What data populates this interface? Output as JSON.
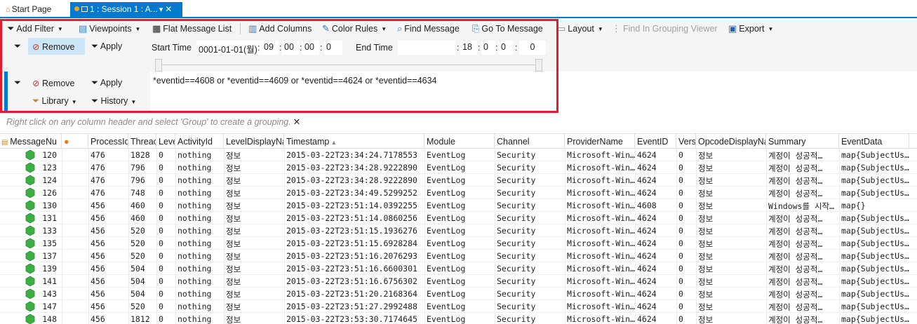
{
  "tabs": {
    "start": "Start Page",
    "session": "1 : Session 1 : A..."
  },
  "toolbar": {
    "add_filter": "Add Filter",
    "viewpoints": "Viewpoints",
    "flat_message_list": "Flat Message List",
    "add_columns": "Add Columns",
    "color_rules": "Color Rules",
    "find_message": "Find Message",
    "go_to_message": "Go To Message",
    "layout": "Layout",
    "find_in_grouping": "Find In Grouping Viewer",
    "export": "Export"
  },
  "time_filter": {
    "remove": "Remove",
    "apply": "Apply",
    "start_label": "Start Time",
    "start_date": "0001-01-01(월)",
    "start_h": "09",
    "start_m": "00",
    "start_s": "00",
    "start_f": "0",
    "end_label": "End Time",
    "end_date": "",
    "end_h": "18",
    "end_m": "0",
    "end_s": "0",
    "end_f": "0"
  },
  "filter": {
    "remove": "Remove",
    "apply": "Apply",
    "library": "Library",
    "history": "History",
    "expression": "*eventid==4608 or *eventid==4609 or *eventid==4624 or *eventid==4634"
  },
  "grouping_hint": "Right click on any column header and select 'Group' to create a grouping.",
  "grid": {
    "columns": [
      "MessageNu",
      "",
      "ProcessId",
      "Threac",
      "Leve",
      "ActivityId",
      "LevelDisplayNa",
      "Timestamp",
      "Module",
      "Channel",
      "ProviderName",
      "EventID",
      "Vers",
      "OpcodeDisplayNa",
      "Summary",
      "EventData"
    ],
    "rows": [
      [
        "120",
        "476",
        "1828",
        "0",
        "nothing",
        "정보",
        "2015-03-22T23:34:24.7178553",
        "EventLog",
        "Security",
        "Microsoft-Win…",
        "4624",
        "0",
        "정보",
        "계정이 성공적…",
        "map{SubjectUs…"
      ],
      [
        "123",
        "476",
        "796",
        "0",
        "nothing",
        "정보",
        "2015-03-22T23:34:28.9222890",
        "EventLog",
        "Security",
        "Microsoft-Win…",
        "4624",
        "0",
        "정보",
        "계정이 성공적…",
        "map{SubjectUs…"
      ],
      [
        "124",
        "476",
        "796",
        "0",
        "nothing",
        "정보",
        "2015-03-22T23:34:28.9222890",
        "EventLog",
        "Security",
        "Microsoft-Win…",
        "4624",
        "0",
        "정보",
        "계정이 성공적…",
        "map{SubjectUs…"
      ],
      [
        "126",
        "476",
        "748",
        "0",
        "nothing",
        "정보",
        "2015-03-22T23:34:49.5299252",
        "EventLog",
        "Security",
        "Microsoft-Win…",
        "4624",
        "0",
        "정보",
        "계정이 성공적…",
        "map{SubjectUs…"
      ],
      [
        "130",
        "456",
        "460",
        "0",
        "nothing",
        "정보",
        "2015-03-22T23:51:14.0392255",
        "EventLog",
        "Security",
        "Microsoft-Win…",
        "4608",
        "0",
        "정보",
        "Windows를 시작…",
        "map{}"
      ],
      [
        "131",
        "456",
        "460",
        "0",
        "nothing",
        "정보",
        "2015-03-22T23:51:14.0860256",
        "EventLog",
        "Security",
        "Microsoft-Win…",
        "4624",
        "0",
        "정보",
        "계정이 성공적…",
        "map{SubjectUs…"
      ],
      [
        "133",
        "456",
        "520",
        "0",
        "nothing",
        "정보",
        "2015-03-22T23:51:15.1936276",
        "EventLog",
        "Security",
        "Microsoft-Win…",
        "4624",
        "0",
        "정보",
        "계정이 성공적…",
        "map{SubjectUs…"
      ],
      [
        "135",
        "456",
        "520",
        "0",
        "nothing",
        "정보",
        "2015-03-22T23:51:15.6928284",
        "EventLog",
        "Security",
        "Microsoft-Win…",
        "4624",
        "0",
        "정보",
        "계정이 성공적…",
        "map{SubjectUs…"
      ],
      [
        "137",
        "456",
        "520",
        "0",
        "nothing",
        "정보",
        "2015-03-22T23:51:16.2076293",
        "EventLog",
        "Security",
        "Microsoft-Win…",
        "4624",
        "0",
        "정보",
        "계정이 성공적…",
        "map{SubjectUs…"
      ],
      [
        "139",
        "456",
        "504",
        "0",
        "nothing",
        "정보",
        "2015-03-22T23:51:16.6600301",
        "EventLog",
        "Security",
        "Microsoft-Win…",
        "4624",
        "0",
        "정보",
        "계정이 성공적…",
        "map{SubjectUs…"
      ],
      [
        "141",
        "456",
        "504",
        "0",
        "nothing",
        "정보",
        "2015-03-22T23:51:16.6756302",
        "EventLog",
        "Security",
        "Microsoft-Win…",
        "4624",
        "0",
        "정보",
        "계정이 성공적…",
        "map{SubjectUs…"
      ],
      [
        "143",
        "456",
        "504",
        "0",
        "nothing",
        "정보",
        "2015-03-22T23:51:20.2168364",
        "EventLog",
        "Security",
        "Microsoft-Win…",
        "4624",
        "0",
        "정보",
        "계정이 성공적…",
        "map{SubjectUs…"
      ],
      [
        "147",
        "456",
        "520",
        "0",
        "nothing",
        "정보",
        "2015-03-22T23:51:27.2992488",
        "EventLog",
        "Security",
        "Microsoft-Win…",
        "4624",
        "0",
        "정보",
        "계정이 성공적…",
        "map{SubjectUs…"
      ],
      [
        "148",
        "456",
        "1812",
        "0",
        "nothing",
        "정보",
        "2015-03-22T23:53:30.7174645",
        "EventLog",
        "Security",
        "Microsoft-Win…",
        "4624",
        "0",
        "정보",
        "계정이 성공적…",
        "map{SubjectUs…"
      ]
    ]
  },
  "colors": {
    "accent": "#007acc",
    "highlight_frame": "#e01c2d",
    "row_icon": "#3cb043"
  },
  "icons": [
    "home-icon",
    "session-icon",
    "pin-icon",
    "close-icon",
    "filter-icon",
    "viewpoints-icon",
    "flat-list-icon",
    "add-columns-icon",
    "color-rules-icon",
    "find-message-icon",
    "go-to-message-icon",
    "layout-icon",
    "grouping-viewer-icon",
    "export-icon",
    "remove-filter-icon",
    "library-icon",
    "history-icon",
    "sort-ascending-icon",
    "message-hexagon-icon",
    "diagnosis-icon"
  ]
}
